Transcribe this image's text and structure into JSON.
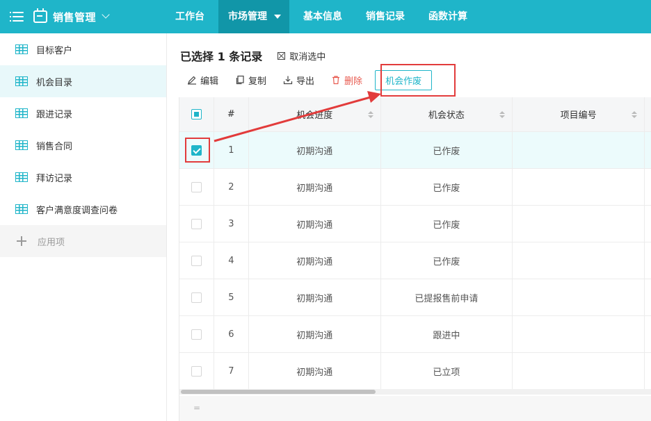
{
  "app": {
    "title": "销售管理"
  },
  "nav": {
    "items": [
      "工作台",
      "市场管理",
      "基本信息",
      "销售记录",
      "函数计算"
    ],
    "active_index": 1
  },
  "sidebar": {
    "items": [
      {
        "label": "目标客户"
      },
      {
        "label": "机会目录"
      },
      {
        "label": "跟进记录"
      },
      {
        "label": "销售合同"
      },
      {
        "label": "拜访记录"
      },
      {
        "label": "客户满意度调查问卷"
      }
    ],
    "active_index": 1,
    "add_label": "应用项"
  },
  "selection": {
    "summary": "已选择 1 条记录",
    "deselect_label": "取消选中"
  },
  "toolbar": {
    "edit": "编辑",
    "copy": "复制",
    "export": "导出",
    "delete": "删除",
    "void": "机会作废"
  },
  "table": {
    "headers": {
      "index": "#",
      "progress": "机会进度",
      "status": "机会状态",
      "project": "项目编号"
    },
    "rows": [
      {
        "index": "1",
        "progress": "初期沟通",
        "status": "已作废",
        "project": "",
        "checked": true
      },
      {
        "index": "2",
        "progress": "初期沟通",
        "status": "已作废",
        "project": "",
        "checked": false
      },
      {
        "index": "3",
        "progress": "初期沟通",
        "status": "已作废",
        "project": "",
        "checked": false
      },
      {
        "index": "4",
        "progress": "初期沟通",
        "status": "已作废",
        "project": "",
        "checked": false
      },
      {
        "index": "5",
        "progress": "初期沟通",
        "status": "已提报售前申请",
        "project": "",
        "checked": false
      },
      {
        "index": "6",
        "progress": "初期沟通",
        "status": "跟进中",
        "project": "",
        "checked": false
      },
      {
        "index": "7",
        "progress": "初期沟通",
        "status": "已立项",
        "project": "",
        "checked": false
      }
    ],
    "footer_text": "="
  },
  "colors": {
    "brand": "#1fb5c9",
    "nav_active": "#1196a8",
    "danger": "#e85a4f",
    "annotation": "#e23b3b",
    "selected_row": "#ecfbfc"
  }
}
